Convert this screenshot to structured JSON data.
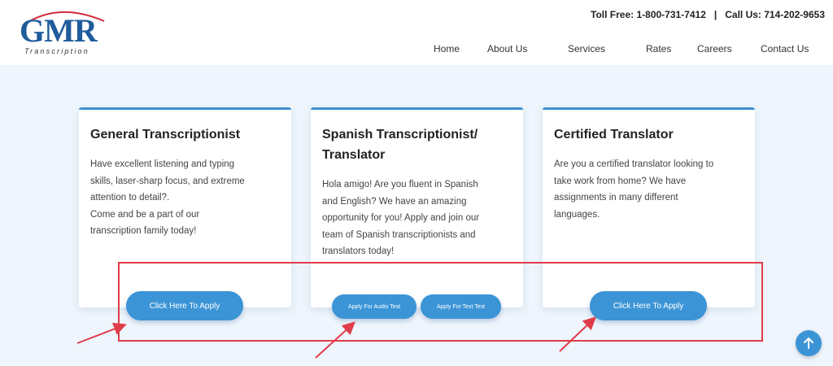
{
  "logo": {
    "main": "GMR",
    "sub": "Transcription"
  },
  "contact": {
    "toll_free": "Toll Free: 1-800-731-7412",
    "separator": "|",
    "call_us": "Call Us: 714-202-9653"
  },
  "nav": {
    "items": [
      {
        "label": "Home"
      },
      {
        "label": "About Us"
      },
      {
        "label": "Services"
      },
      {
        "label": "Rates"
      },
      {
        "label": "Careers"
      },
      {
        "label": "Contact Us"
      }
    ]
  },
  "cards": [
    {
      "title": "General Transcriptionist",
      "body": [
        "Have excellent listening and typing",
        "skills, laser-sharp focus, and extreme",
        "attention to detail?.",
        "Come and be a part of our",
        "transcription family today!"
      ],
      "button": "Click Here To Apply"
    },
    {
      "title": [
        "Spanish Transcriptionist/",
        "Translator"
      ],
      "body": [
        "Hola amigo! Are you fluent in Spanish",
        "and English? We have an amazing",
        "opportunity for you! Apply and join our",
        "team of Spanish transcriptionists and",
        "translators today!"
      ],
      "buttons": [
        "Apply For Audio Test",
        "Apply For Text Test"
      ]
    },
    {
      "title": "Certified Translator",
      "body": [
        "Are you a certified translator looking to",
        "take work from home? We have",
        "assignments in many different",
        "languages."
      ],
      "button": "Click Here To Apply"
    }
  ],
  "colors": {
    "brand_blue": "#1f5c9c",
    "accent_blue": "#3b94d6",
    "annotation_red": "#e03c4a",
    "page_bg": "#eef5fc"
  },
  "icons": {
    "scroll_top": "arrow-up-icon"
  }
}
